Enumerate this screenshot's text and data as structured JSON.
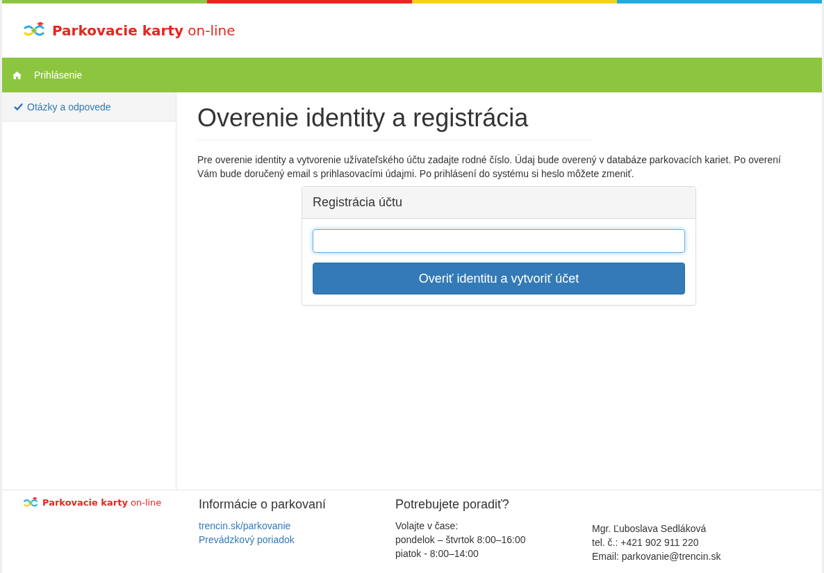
{
  "header": {
    "logo": "**Parkovacie karty** on-line"
  },
  "navbar": {
    "items": [
      {
        "label": "Prihlásenie"
      }
    ]
  },
  "sidebar": {
    "items": [
      {
        "label": "Otázky a odpovede"
      }
    ]
  },
  "main": {
    "title": "Overenie identity a registrácia",
    "description": "Pre overenie identity a vytvorenie užívateľského účtu zadajte rodné číslo. Údaj bude overený v databáze parkovacích kariet. Po overení Vám bude doručený email s prihlasovacími údajmi. Po prihlásení do systému si heslo môžete zmeniť.",
    "panel": {
      "heading": "Registrácia účtu",
      "button": "Overiť identitu a vytvoriť účet"
    }
  },
  "footer": {
    "logo": "**Parkovacie karty** on-line",
    "info": {
      "heading": "Informácie o parkovaní",
      "links": [
        "trencin.sk/parkovanie",
        "Prevádzkový poriadok"
      ]
    },
    "help": {
      "heading": "Potrebujete poradiť?",
      "hours": [
        "Volajte v čase:",
        "pondelok – štvrtok 8:00–16:00",
        "piatok - 8:00–14:00"
      ],
      "contact": [
        "Mgr. Ľuboslava Sedláková",
        "tel. č.: +421 902 911 220",
        "Email: parkovanie@trencin.sk"
      ]
    }
  }
}
